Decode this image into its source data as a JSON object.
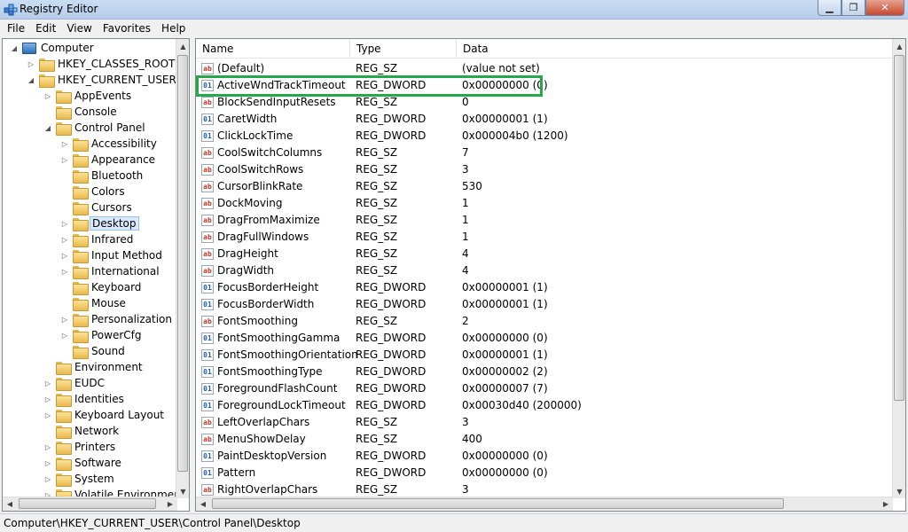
{
  "window": {
    "title": "Registry Editor"
  },
  "menu": [
    "File",
    "Edit",
    "View",
    "Favorites",
    "Help"
  ],
  "tree": [
    {
      "label": "Computer",
      "level": 0,
      "expander": "expanded",
      "icon": "computer-icon"
    },
    {
      "label": "HKEY_CLASSES_ROOT",
      "level": 1,
      "expander": "collapsed"
    },
    {
      "label": "HKEY_CURRENT_USER",
      "level": 1,
      "expander": "expanded"
    },
    {
      "label": "AppEvents",
      "level": 2,
      "expander": "collapsed"
    },
    {
      "label": "Console",
      "level": 2,
      "expander": "none"
    },
    {
      "label": "Control Panel",
      "level": 2,
      "expander": "expanded"
    },
    {
      "label": "Accessibility",
      "level": 3,
      "expander": "collapsed"
    },
    {
      "label": "Appearance",
      "level": 3,
      "expander": "collapsed"
    },
    {
      "label": "Bluetooth",
      "level": 3,
      "expander": "none"
    },
    {
      "label": "Colors",
      "level": 3,
      "expander": "none"
    },
    {
      "label": "Cursors",
      "level": 3,
      "expander": "none"
    },
    {
      "label": "Desktop",
      "level": 3,
      "expander": "collapsed",
      "selected": true
    },
    {
      "label": "Infrared",
      "level": 3,
      "expander": "collapsed"
    },
    {
      "label": "Input Method",
      "level": 3,
      "expander": "collapsed"
    },
    {
      "label": "International",
      "level": 3,
      "expander": "collapsed"
    },
    {
      "label": "Keyboard",
      "level": 3,
      "expander": "none"
    },
    {
      "label": "Mouse",
      "level": 3,
      "expander": "none"
    },
    {
      "label": "Personalization",
      "level": 3,
      "expander": "collapsed"
    },
    {
      "label": "PowerCfg",
      "level": 3,
      "expander": "collapsed"
    },
    {
      "label": "Sound",
      "level": 3,
      "expander": "none"
    },
    {
      "label": "Environment",
      "level": 2,
      "expander": "none"
    },
    {
      "label": "EUDC",
      "level": 2,
      "expander": "collapsed"
    },
    {
      "label": "Identities",
      "level": 2,
      "expander": "collapsed"
    },
    {
      "label": "Keyboard Layout",
      "level": 2,
      "expander": "collapsed"
    },
    {
      "label": "Network",
      "level": 2,
      "expander": "none"
    },
    {
      "label": "Printers",
      "level": 2,
      "expander": "collapsed"
    },
    {
      "label": "Software",
      "level": 2,
      "expander": "collapsed"
    },
    {
      "label": "System",
      "level": 2,
      "expander": "collapsed"
    },
    {
      "label": "Volatile Environment",
      "level": 2,
      "expander": "collapsed"
    }
  ],
  "list": {
    "columns": [
      "Name",
      "Type",
      "Data"
    ],
    "highlighted_row": 1,
    "highlight_color": "#26a84a",
    "rows": [
      {
        "name": "(Default)",
        "type": "REG_SZ",
        "data": "(value not set)"
      },
      {
        "name": "ActiveWndTrackTimeout",
        "type": "REG_DWORD",
        "data": "0x00000000 (0)"
      },
      {
        "name": "BlockSendInputResets",
        "type": "REG_SZ",
        "data": "0"
      },
      {
        "name": "CaretWidth",
        "type": "REG_DWORD",
        "data": "0x00000001 (1)"
      },
      {
        "name": "ClickLockTime",
        "type": "REG_DWORD",
        "data": "0x000004b0 (1200)"
      },
      {
        "name": "CoolSwitchColumns",
        "type": "REG_SZ",
        "data": "7"
      },
      {
        "name": "CoolSwitchRows",
        "type": "REG_SZ",
        "data": "3"
      },
      {
        "name": "CursorBlinkRate",
        "type": "REG_SZ",
        "data": "530"
      },
      {
        "name": "DockMoving",
        "type": "REG_SZ",
        "data": "1"
      },
      {
        "name": "DragFromMaximize",
        "type": "REG_SZ",
        "data": "1"
      },
      {
        "name": "DragFullWindows",
        "type": "REG_SZ",
        "data": "1"
      },
      {
        "name": "DragHeight",
        "type": "REG_SZ",
        "data": "4"
      },
      {
        "name": "DragWidth",
        "type": "REG_SZ",
        "data": "4"
      },
      {
        "name": "FocusBorderHeight",
        "type": "REG_DWORD",
        "data": "0x00000001 (1)"
      },
      {
        "name": "FocusBorderWidth",
        "type": "REG_DWORD",
        "data": "0x00000001 (1)"
      },
      {
        "name": "FontSmoothing",
        "type": "REG_SZ",
        "data": "2"
      },
      {
        "name": "FontSmoothingGamma",
        "type": "REG_DWORD",
        "data": "0x00000000 (0)"
      },
      {
        "name": "FontSmoothingOrientation",
        "type": "REG_DWORD",
        "data": "0x00000001 (1)"
      },
      {
        "name": "FontSmoothingType",
        "type": "REG_DWORD",
        "data": "0x00000002 (2)"
      },
      {
        "name": "ForegroundFlashCount",
        "type": "REG_DWORD",
        "data": "0x00000007 (7)"
      },
      {
        "name": "ForegroundLockTimeout",
        "type": "REG_DWORD",
        "data": "0x00030d40 (200000)"
      },
      {
        "name": "LeftOverlapChars",
        "type": "REG_SZ",
        "data": "3"
      },
      {
        "name": "MenuShowDelay",
        "type": "REG_SZ",
        "data": "400"
      },
      {
        "name": "PaintDesktopVersion",
        "type": "REG_DWORD",
        "data": "0x00000000 (0)"
      },
      {
        "name": "Pattern",
        "type": "REG_DWORD",
        "data": "0x00000000 (0)"
      },
      {
        "name": "RightOverlapChars",
        "type": "REG_SZ",
        "data": "3"
      }
    ]
  },
  "status_bar": {
    "path": "Computer\\HKEY_CURRENT_USER\\Control Panel\\Desktop"
  }
}
